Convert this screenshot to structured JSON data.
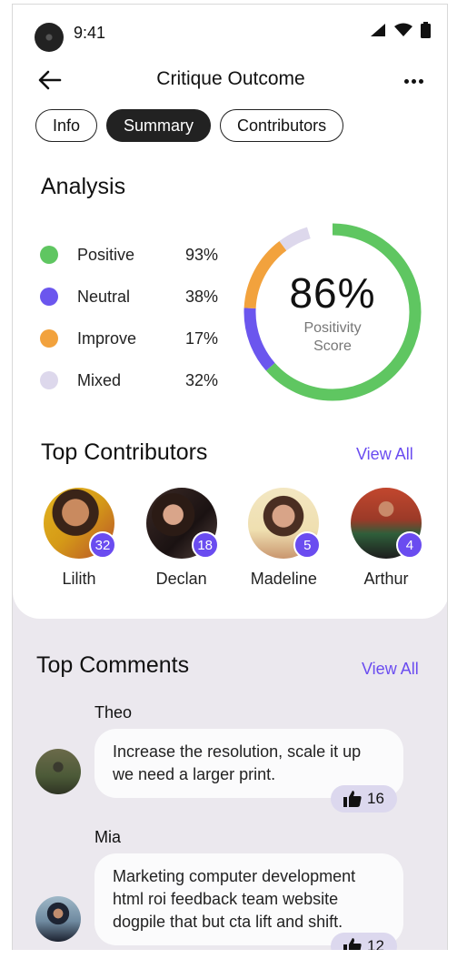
{
  "status_bar": {
    "time": "9:41"
  },
  "header": {
    "title": "Critique Outcome"
  },
  "tabs": [
    {
      "label": "Info",
      "active": false
    },
    {
      "label": "Summary",
      "active": true
    },
    {
      "label": "Contributors",
      "active": false
    }
  ],
  "analysis": {
    "title": "Analysis",
    "items": [
      {
        "label": "Positive",
        "value": "93%",
        "color": "#5fc661"
      },
      {
        "label": "Neutral",
        "value": "38%",
        "color": "#6b56ee"
      },
      {
        "label": "Improve",
        "value": "17%",
        "color": "#f2a23d"
      },
      {
        "label": "Mixed",
        "value": "32%",
        "color": "#ddd8ec"
      }
    ],
    "score": {
      "value": "86%",
      "label": "Positivity Score"
    }
  },
  "top_contributors": {
    "title": "Top Contributors",
    "view_all": "View All",
    "people": [
      {
        "name": "Lilith",
        "count": "32"
      },
      {
        "name": "Declan",
        "count": "18"
      },
      {
        "name": "Madeline",
        "count": "5"
      },
      {
        "name": "Arthur",
        "count": "4"
      }
    ]
  },
  "top_comments": {
    "title": "Top Comments",
    "view_all": "View All",
    "comments": [
      {
        "author": "Theo",
        "text": "Increase the resolution, scale it up we need a larger print.",
        "likes": "16"
      },
      {
        "author": "Mia",
        "text": "Marketing computer development html roi feedback team website dogpile that but cta lift and shift.",
        "likes": "12"
      }
    ]
  },
  "colors": {
    "accent": "#6a4cf0",
    "positive": "#5fc661",
    "neutral": "#6b56ee",
    "improve": "#f2a23d",
    "mixed": "#ddd8ec"
  }
}
